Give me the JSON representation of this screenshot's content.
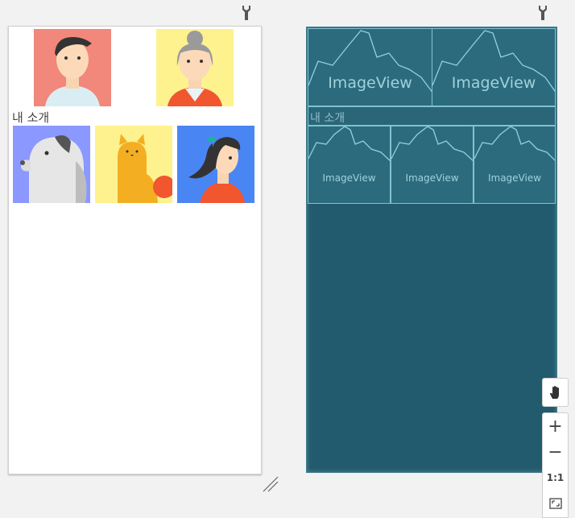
{
  "design": {
    "intro_text": "내 소개"
  },
  "blueprint": {
    "image_label": "ImageView",
    "intro_text": "내 소개"
  },
  "zoom": {
    "pan_icon": "hand-icon",
    "zoom_in": "+",
    "zoom_out": "−",
    "one_to_one": "1:1",
    "fit_icon": "fit-screen-icon"
  },
  "colors": {
    "blueprint_bg": "#225b6d",
    "blueprint_cell": "#2c6b7d",
    "blueprint_line": "#7fc3d2"
  }
}
